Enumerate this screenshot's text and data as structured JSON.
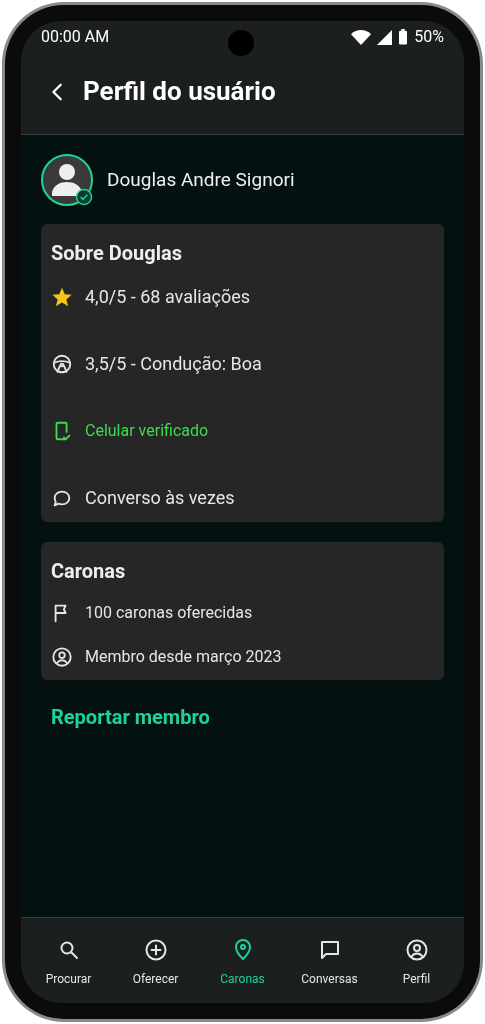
{
  "status_bar": {
    "time": "00:00 AM",
    "battery": "50%"
  },
  "header": {
    "title": "Perfil do usuário"
  },
  "profile": {
    "name": "Douglas Andre Signori",
    "verified": true
  },
  "about": {
    "title": "Sobre Douglas",
    "items": [
      {
        "kind": "rating",
        "text": "4,0/5 - 68 avaliações",
        "verified": false
      },
      {
        "kind": "driving",
        "text": "3,5/5 - Condução: Boa",
        "verified": false
      },
      {
        "kind": "phone",
        "text": "Celular verificado",
        "verified": true
      },
      {
        "kind": "chat",
        "text": "Converso às vezes",
        "verified": false
      }
    ]
  },
  "rides": {
    "title": "Caronas",
    "items": [
      {
        "kind": "flag",
        "text": "100 caronas oferecidas"
      },
      {
        "kind": "member",
        "text": "Membro desde março 2023"
      }
    ]
  },
  "report_link": "Reportar membro",
  "nav": [
    {
      "kind": "search",
      "label": "Procurar",
      "selected": false
    },
    {
      "kind": "add",
      "label": "Oferecer",
      "selected": false
    },
    {
      "kind": "pin",
      "label": "Caronas",
      "selected": true
    },
    {
      "kind": "chat",
      "label": "Conversas",
      "selected": false
    },
    {
      "kind": "profile",
      "label": "Perfil",
      "selected": false
    }
  ]
}
